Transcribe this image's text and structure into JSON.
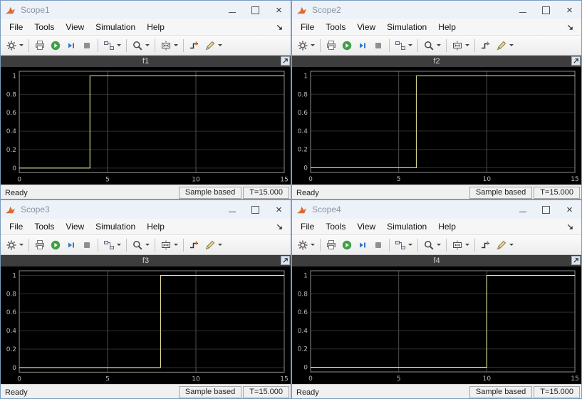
{
  "colors": {
    "window_border": "#7b9cc0",
    "titlebar_bg": "#edf2f9",
    "title_text": "#8a93a0",
    "plot_bg": "#000000",
    "plot_title_bg": "#3d3d3d",
    "plot_title_text": "#d4d4d4",
    "grid_horizontal": "#2e2e2e",
    "grid_vertical": "#4d4d4d",
    "plot_box_border": "#8c8c8c",
    "tick_text": "#b9b9b9",
    "line_color": "#f3efa4",
    "matlab_orange": "#dd6a2f",
    "run_green": "#3f9f44",
    "step_blue": "#2c77c9"
  },
  "menu": {
    "items": [
      "File",
      "Tools",
      "View",
      "Simulation",
      "Help"
    ]
  },
  "toolbar": {
    "groups": [
      [
        {
          "name": "settings-gear-icon",
          "caret": true
        }
      ],
      [
        {
          "name": "print-icon"
        },
        {
          "name": "run-icon"
        },
        {
          "name": "step-forward-icon"
        },
        {
          "name": "stop-icon"
        }
      ],
      [
        {
          "name": "signal-selector-icon",
          "caret": true
        }
      ],
      [
        {
          "name": "zoom-icon",
          "caret": true
        }
      ],
      [
        {
          "name": "fit-view-icon",
          "caret": true
        }
      ],
      [
        {
          "name": "trigger-icon"
        },
        {
          "name": "measurements-icon",
          "caret": true
        }
      ]
    ]
  },
  "window_buttons": {
    "close_glyph": "×"
  },
  "statusbar": {
    "ready": "Ready",
    "sample": "Sample based",
    "time": "T=15.000"
  },
  "scopes": [
    {
      "title": "Scope1"
    },
    {
      "title": "Scope2"
    },
    {
      "title": "Scope3"
    },
    {
      "title": "Scope4"
    }
  ],
  "chart_data": [
    {
      "type": "line",
      "title": "f1",
      "xlim": [
        0,
        15
      ],
      "ylim": [
        -0.05,
        1.05
      ],
      "x_ticks": [
        0,
        5,
        10,
        15
      ],
      "y_ticks": [
        0,
        0.2,
        0.4,
        0.6,
        0.8,
        1
      ],
      "grid": true,
      "legend": false,
      "step_time": 4,
      "series": [
        {
          "name": "f1",
          "color": "#f3efa4",
          "x": [
            0,
            4,
            4,
            15
          ],
          "y": [
            0,
            0,
            1,
            1
          ]
        }
      ]
    },
    {
      "type": "line",
      "title": "f2",
      "xlim": [
        0,
        15
      ],
      "ylim": [
        -0.05,
        1.05
      ],
      "x_ticks": [
        0,
        5,
        10,
        15
      ],
      "y_ticks": [
        0,
        0.2,
        0.4,
        0.6,
        0.8,
        1
      ],
      "grid": true,
      "legend": false,
      "step_time": 6,
      "series": [
        {
          "name": "f2",
          "color": "#f3efa4",
          "x": [
            0,
            6,
            6,
            15
          ],
          "y": [
            0,
            0,
            1,
            1
          ]
        }
      ]
    },
    {
      "type": "line",
      "title": "f3",
      "xlim": [
        0,
        15
      ],
      "ylim": [
        -0.05,
        1.05
      ],
      "x_ticks": [
        0,
        5,
        10,
        15
      ],
      "y_ticks": [
        0,
        0.2,
        0.4,
        0.6,
        0.8,
        1
      ],
      "grid": true,
      "legend": false,
      "step_time": 8,
      "series": [
        {
          "name": "f3",
          "color": "#f3efa4",
          "x": [
            0,
            8,
            8,
            15
          ],
          "y": [
            0,
            0,
            1,
            1
          ]
        }
      ]
    },
    {
      "type": "line",
      "title": "f4",
      "xlim": [
        0,
        15
      ],
      "ylim": [
        -0.05,
        1.05
      ],
      "x_ticks": [
        0,
        5,
        10,
        15
      ],
      "y_ticks": [
        0,
        0.2,
        0.4,
        0.6,
        0.8,
        1
      ],
      "grid": true,
      "legend": false,
      "step_time": 10,
      "series": [
        {
          "name": "f4",
          "color": "#f3efa4",
          "x": [
            0,
            10,
            10,
            15
          ],
          "y": [
            0,
            0,
            1,
            1
          ]
        }
      ]
    }
  ]
}
